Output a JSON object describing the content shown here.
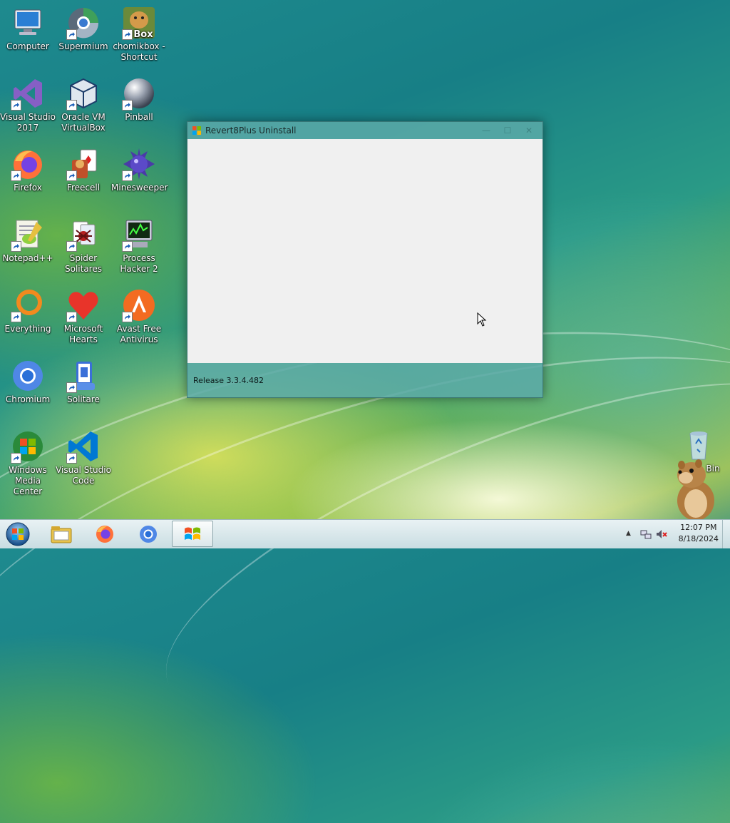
{
  "desktop": {
    "icons": [
      {
        "label": "Computer",
        "icon": "computer-icon"
      },
      {
        "label": "Supermium",
        "icon": "supermium-icon"
      },
      {
        "label": "chomikbox - Shortcut",
        "icon": "chomikbox-icon",
        "logo_text": "Box"
      },
      {
        "label": "Visual Studio 2017",
        "icon": "visual-studio-icon"
      },
      {
        "label": "Oracle VM VirtualBox",
        "icon": "virtualbox-icon"
      },
      {
        "label": "Pinball",
        "icon": "pinball-icon"
      },
      {
        "label": "Firefox",
        "icon": "firefox-icon"
      },
      {
        "label": "Freecell",
        "icon": "freecell-icon"
      },
      {
        "label": "Minesweeper",
        "icon": "minesweeper-icon"
      },
      {
        "label": "Notepad++",
        "icon": "notepadpp-icon"
      },
      {
        "label": "Spider Solitares",
        "icon": "spider-solitaire-icon"
      },
      {
        "label": "Process Hacker 2",
        "icon": "process-hacker-icon"
      },
      {
        "label": "Everything",
        "icon": "everything-icon"
      },
      {
        "label": "Microsoft Hearts",
        "icon": "hearts-icon"
      },
      {
        "label": "Avast Free Antivirus",
        "icon": "avast-icon"
      },
      {
        "label": "Chromium",
        "icon": "chromium-icon"
      },
      {
        "label": "Solitare",
        "icon": "solitaire-icon"
      },
      {
        "label": "Windows Media Center",
        "icon": "media-center-icon"
      },
      {
        "label": "Visual Studio Code",
        "icon": "vscode-icon"
      },
      {
        "label": "Bin",
        "icon": "recycle-bin-icon"
      }
    ]
  },
  "window": {
    "title": "Revert8Plus Uninstall",
    "minimize_glyph": "—",
    "maximize_glyph": "☐",
    "close_glyph": "✕",
    "footer_text": "Release 3.3.4.482"
  },
  "taskbar": {
    "start": "start-orb-icon",
    "items": [
      "explorer-icon",
      "firefox-icon",
      "chromium-icon",
      "windows-flag-icon"
    ],
    "tray": {
      "show_hidden": "▲",
      "time": "12:07 PM",
      "date": "8/18/2024"
    }
  },
  "colors": {
    "window_glass": "#5caaa8",
    "client": "#f0f0f0",
    "taskbar": "#d8e8ec"
  }
}
